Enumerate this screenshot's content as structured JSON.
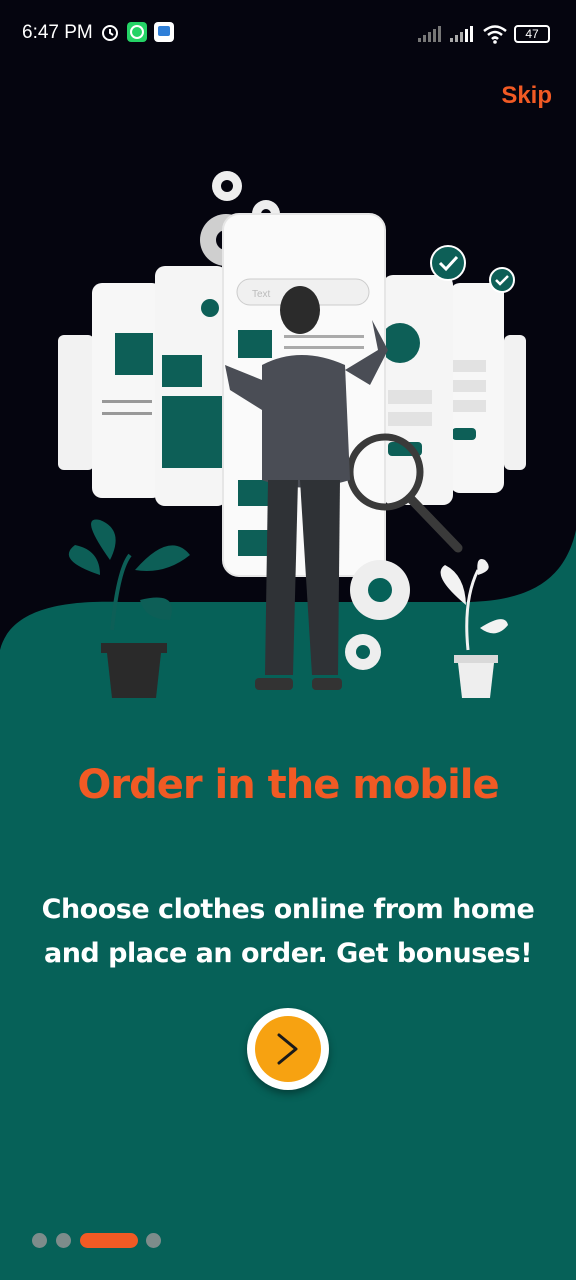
{
  "status_bar": {
    "time": "6:47 PM",
    "battery": "47",
    "icons": [
      "alarm-icon",
      "whatsapp-icon",
      "app-icon",
      "signal-icon",
      "signal-icon",
      "wifi-icon",
      "battery-icon"
    ]
  },
  "skip_label": "Skip",
  "illustration": {
    "search_placeholder": "Text"
  },
  "title": "Order in the mobile",
  "subtitle": "Choose clothes online from home and place an order. Get bonuses!",
  "next_icon": "chevron-right-icon",
  "pagination": {
    "count": 4,
    "active": 2
  },
  "colors": {
    "background_top": "#05050f",
    "background_bottom": "#066158",
    "accent": "#f15a24",
    "button": "#f7a211",
    "dot_inactive": "#7d8c8b"
  }
}
